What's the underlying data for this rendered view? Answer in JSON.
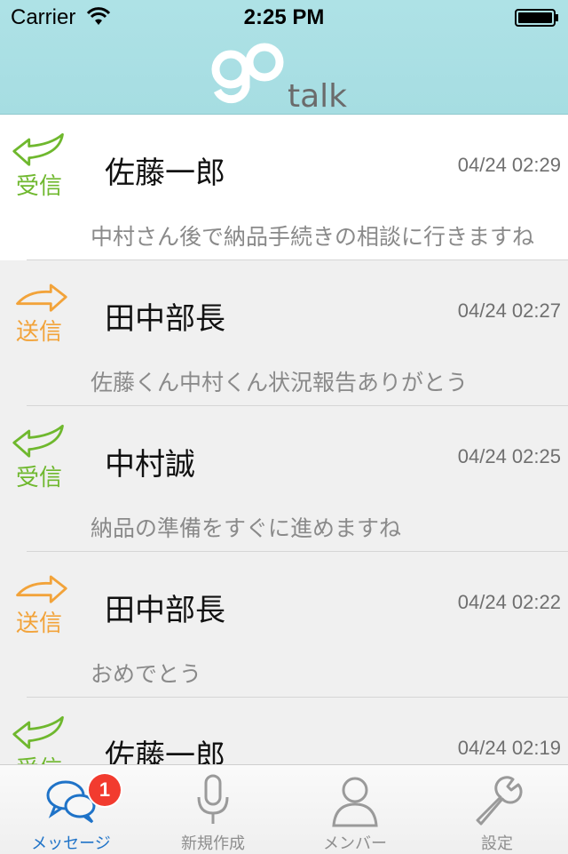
{
  "status_bar": {
    "carrier": "Carrier",
    "time": "2:25 PM"
  },
  "header": {
    "logo_main": "go",
    "logo_sub": "talk"
  },
  "colors": {
    "header_bg": "#a6dde2",
    "received": "#6fb82e",
    "sent": "#f2a33a",
    "active_tab": "#1f73c8",
    "badge": "#f23b2f"
  },
  "messages": [
    {
      "direction": "received",
      "direction_label": "受信",
      "icon": "reply-arrow-icon",
      "name": "佐藤一郎",
      "timestamp": "04/24 02:29",
      "preview": "中村さん後で納品手続きの相談に行きますね"
    },
    {
      "direction": "sent",
      "direction_label": "送信",
      "icon": "forward-arrow-icon",
      "name": "田中部長",
      "timestamp": "04/24 02:27",
      "preview": "佐藤くん中村くん状況報告ありがとう"
    },
    {
      "direction": "received",
      "direction_label": "受信",
      "icon": "reply-arrow-icon",
      "name": "中村誠",
      "timestamp": "04/24 02:25",
      "preview": "納品の準備をすぐに進めますね"
    },
    {
      "direction": "sent",
      "direction_label": "送信",
      "icon": "forward-arrow-icon",
      "name": "田中部長",
      "timestamp": "04/24 02:22",
      "preview": "おめでとう"
    },
    {
      "direction": "received",
      "direction_label": "受信",
      "icon": "reply-arrow-icon",
      "name": "佐藤一郎",
      "timestamp": "04/24 02:19",
      "preview": ""
    }
  ],
  "tabs": [
    {
      "label": "メッセージ",
      "icon": "chat-bubbles-icon",
      "active": true,
      "badge": "1"
    },
    {
      "label": "新規作成",
      "icon": "microphone-icon",
      "active": false
    },
    {
      "label": "メンバー",
      "icon": "person-icon",
      "active": false
    },
    {
      "label": "設定",
      "icon": "wrench-icon",
      "active": false
    }
  ]
}
